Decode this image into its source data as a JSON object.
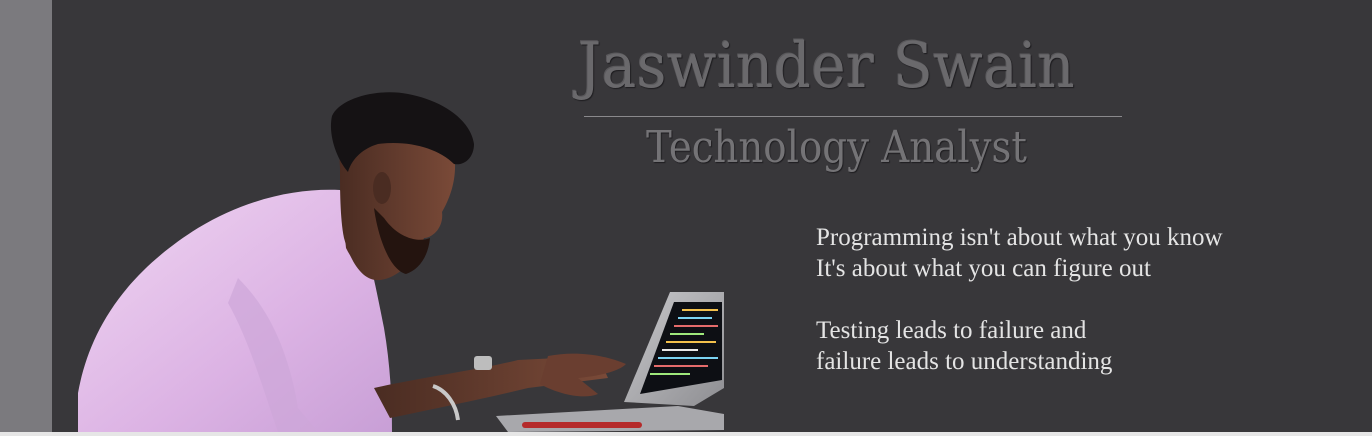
{
  "header": {
    "name": "Jaswinder Swain",
    "job_title": "Technology Analyst"
  },
  "quotes": [
    {
      "line1": "Programming isn't about what you know",
      "line2": "It's about what you can figure out"
    },
    {
      "line1": "Testing leads to failure and",
      "line2": "failure leads to understanding"
    }
  ],
  "colors": {
    "background": "#38373a",
    "rail": "#7b7a7e",
    "title_text": "#6a696c",
    "quote_text": "#e4e4e4",
    "shirt": "#e7c8ec"
  }
}
